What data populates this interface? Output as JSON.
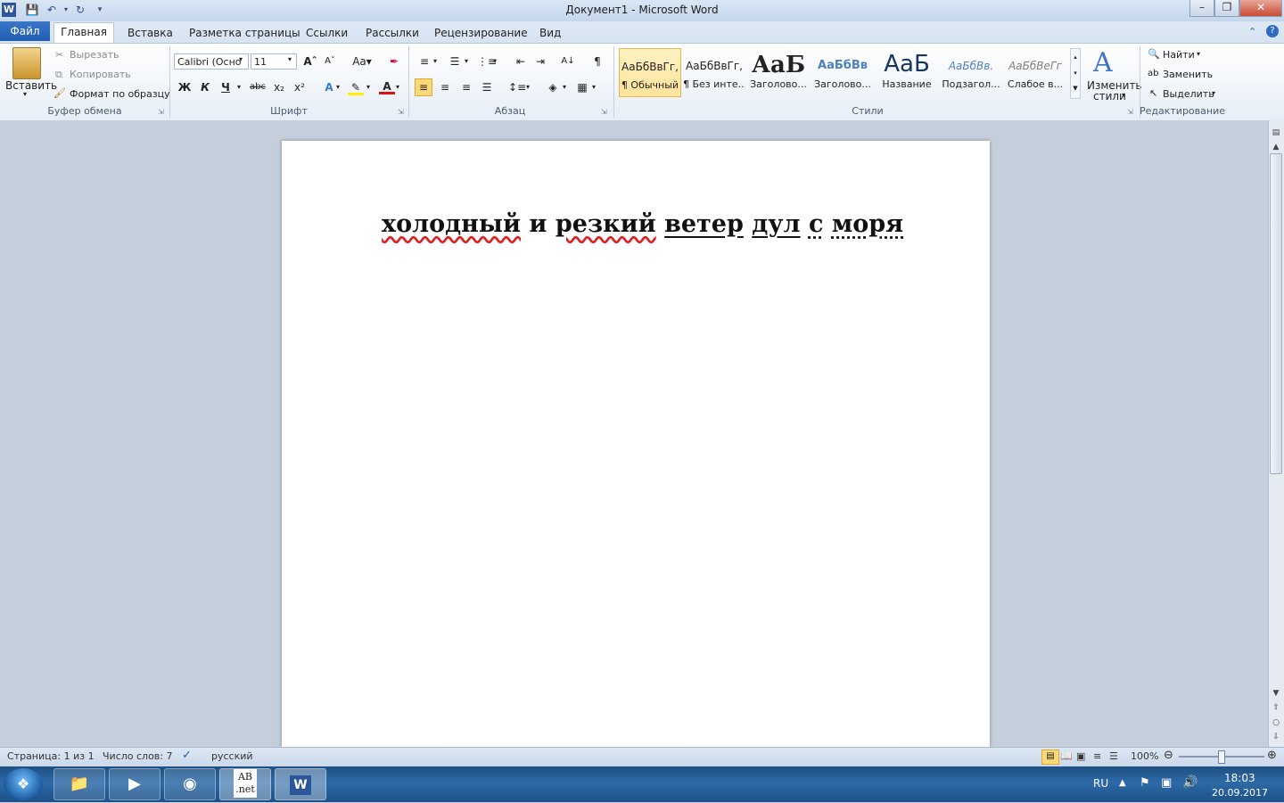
{
  "window": {
    "title": "Документ1  -  Microsoft Word",
    "app_icon": "word-icon",
    "controls": [
      "minimize",
      "maximize",
      "close"
    ]
  },
  "quick_access": {
    "icons": [
      "save-icon",
      "undo-icon",
      "redo-icon",
      "customize-icon"
    ]
  },
  "tabs": {
    "file": "Файл",
    "items": [
      "Главная",
      "Вставка",
      "Разметка страницы",
      "Ссылки",
      "Рассылки",
      "Рецензирование",
      "Вид"
    ]
  },
  "ribbon": {
    "clipboard": {
      "paste": "Вставить",
      "cut": "Вырезать",
      "copy": "Копировать",
      "format_painter": "Формат по образцу",
      "group": "Буфер обмена"
    },
    "font": {
      "font_name": "Calibri (Осно",
      "font_size": "11",
      "bold": "Ж",
      "italic": "К",
      "underline": "Ч",
      "group": "Шрифт"
    },
    "paragraph": {
      "group": "Абзац"
    },
    "styles": {
      "items": [
        {
          "sample": "АаБбВвГг,",
          "label": "¶ Обычный"
        },
        {
          "sample": "АаБбВвГг,",
          "label": "¶ Без инте..."
        },
        {
          "sample": "АаБ",
          "label": "Заголово..."
        },
        {
          "sample": "АаБбВв",
          "label": "Заголово..."
        },
        {
          "sample": "АаБ",
          "label": "Название"
        },
        {
          "sample": "АаБбВв.",
          "label": "Подзагол..."
        },
        {
          "sample": "АаБбВеГг",
          "label": "Слабое в..."
        }
      ],
      "change_styles_1": "Изменить",
      "change_styles_2": "стили",
      "group": "Стили"
    },
    "editing": {
      "find": "Найти",
      "replace": "Заменить",
      "select": "Выделить",
      "group": "Редактирование"
    }
  },
  "document": {
    "words": [
      "холодный",
      "и",
      "резкий",
      "ветер",
      "дул",
      "с",
      "моря"
    ]
  },
  "status": {
    "page": "Страница: 1 из 1",
    "words": "Число слов: 7",
    "language": "русский",
    "zoom": "100%"
  },
  "taskbar": {
    "apps": [
      "explorer-icon",
      "media-player-icon",
      "firefox-icon",
      "abc-net-icon",
      "word-icon"
    ],
    "lang": "RU",
    "time": "18:03",
    "date": "20.09.2017"
  }
}
